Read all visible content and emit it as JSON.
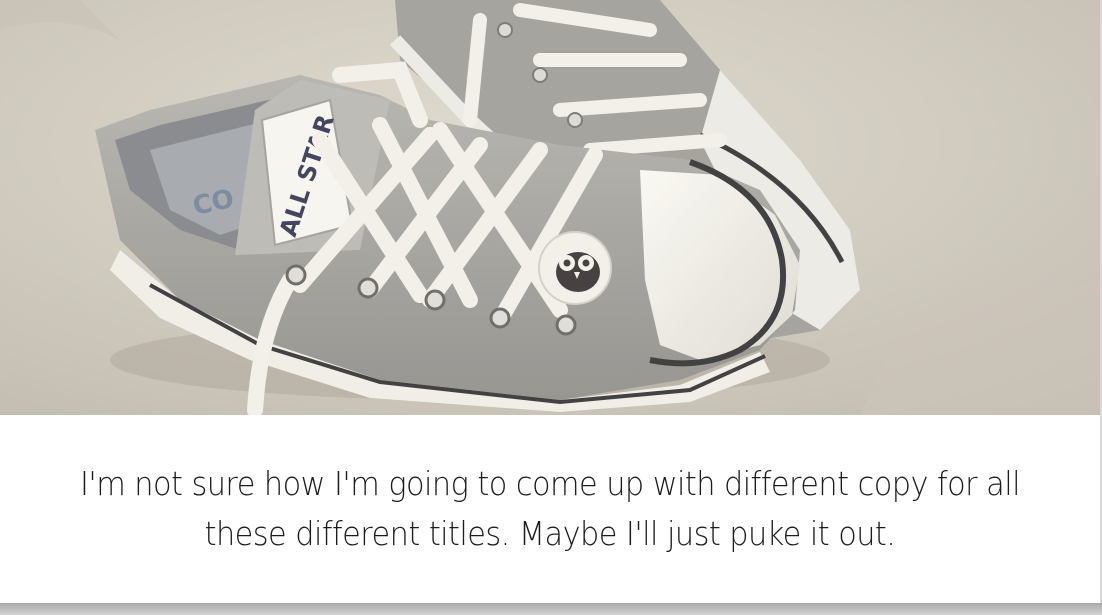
{
  "hero": {
    "image_subject": "gray low-top canvas sneakers with white laces on concrete",
    "tongue_label": "ALL STAR",
    "insole_label": "CO",
    "colors": {
      "concrete": "#cfc9be",
      "canvas": "#9c9c98",
      "rubber": "#efeee9",
      "stripe": "#2b2b2d",
      "lace": "#f3f1ec"
    }
  },
  "caption": {
    "text": "I'm not sure how I'm going to come up with different copy for all these different titles. Maybe I'll just puke it out."
  }
}
